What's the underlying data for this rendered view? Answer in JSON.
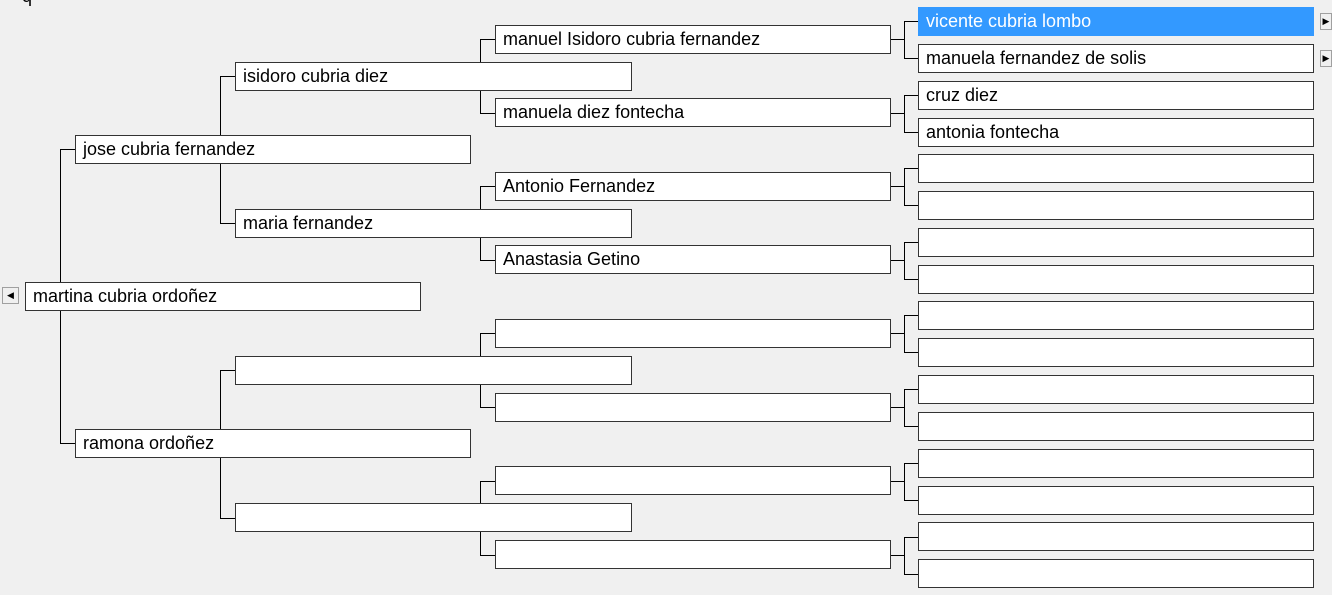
{
  "tree": {
    "root": "martina cubria ordoñez",
    "parents": [
      "jose cubria fernandez",
      "ramona ordoñez"
    ],
    "grandparents": [
      "isidoro cubria diez",
      "maria fernandez",
      "",
      ""
    ],
    "great_grandparents": [
      "manuel Isidoro cubria fernandez",
      "manuela diez fontecha",
      "Antonio Fernandez",
      "Anastasia Getino",
      "",
      "",
      "",
      ""
    ],
    "great_great_grandparents": [
      "vicente cubria lombo",
      "manuela fernandez de solis",
      "cruz diez",
      "antonia fontecha",
      "",
      "",
      "",
      "",
      "",
      "",
      "",
      "",
      "",
      "",
      "",
      ""
    ]
  },
  "nav": {
    "back_arrow": "◀",
    "forward_arrow": "▶"
  },
  "colors": {
    "selected_bg": "#3399ff",
    "selected_text": "#ffffff",
    "background": "#f0f0f0"
  }
}
